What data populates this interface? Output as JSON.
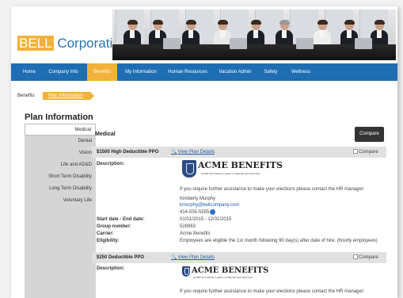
{
  "header": {
    "logo_part1": "BELL",
    "logo_part2": " Corporation"
  },
  "nav": {
    "items": [
      {
        "label": "Home"
      },
      {
        "label": "Company Info"
      },
      {
        "label": "Benefits"
      },
      {
        "label": "My Information"
      },
      {
        "label": "Human Resources"
      },
      {
        "label": "Vacation Admin"
      },
      {
        "label": "Safety"
      },
      {
        "label": "Wellness"
      }
    ],
    "active": "Benefits"
  },
  "breadcrumb": {
    "home": "Benefits",
    "current": "Plan Information"
  },
  "page_title": "Plan Information",
  "sidebar": {
    "items": [
      {
        "label": "Medical"
      },
      {
        "label": "Dental"
      },
      {
        "label": "Vision"
      },
      {
        "label": "Life and AD&D"
      },
      {
        "label": "Short Term Disability"
      },
      {
        "label": "Long Term Disability"
      },
      {
        "label": "Voluntary Life"
      }
    ],
    "active": "Medical"
  },
  "main": {
    "title": "Medical",
    "compare_button": "Compare",
    "plans": [
      {
        "name": "$1500 High Deductible PPO",
        "link": "View Plan Details",
        "compare": "Compare",
        "desc_label": "Description:",
        "logo_name": "ACME BENEFITS",
        "logo_tag": "ACME Worldwide Leader in Benefit and Services",
        "assist": "If you require further assistance to make your elections please contact the HR manager:",
        "contact_name": "Kimberly Murphy",
        "contact_email": "kmurphy@bellcompany.com",
        "contact_phone": "414-555-5555",
        "rows": [
          {
            "label": "Start date - End date:",
            "value": "01/01/2015 - 12/31/2015"
          },
          {
            "label": "Group number:",
            "value": "528963"
          },
          {
            "label": "Carrier:",
            "value": "Acme Benefits"
          },
          {
            "label": "Eligibility:",
            "value": "Employees are eligible the 1st month following 90 day(s) after date of hire. (hourly employees)"
          }
        ]
      },
      {
        "name": "$250 Deductible PPO",
        "link": "View Plan Details",
        "compare": "Compare",
        "desc_label": "Description:",
        "logo_name": "ACME BENEFITS",
        "logo_tag": "ACME Worldwide Leader in Benefit and Services",
        "assist": "If you require further assistance to make your elections please contact the HR manager:"
      }
    ]
  },
  "icons": {
    "search": "magnifier-icon",
    "checkbox": "checkbox-icon",
    "phone": "phone-icon"
  },
  "colors": {
    "nav_blue": "#1f6db3",
    "accent_gold": "#f0b23a",
    "sidebar_gray": "#d5d5d5",
    "dark_button": "#333333"
  }
}
